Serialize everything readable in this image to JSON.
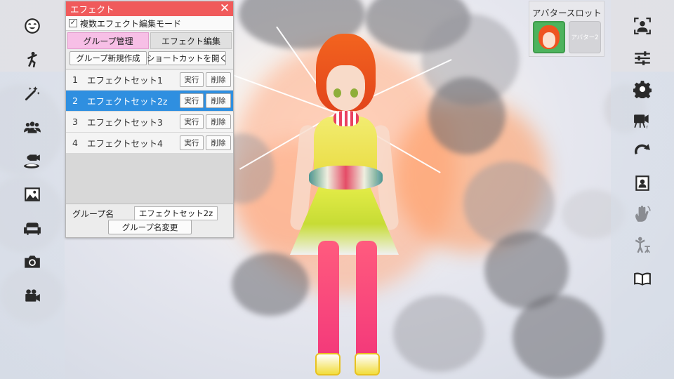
{
  "panel": {
    "title": "エフェクト",
    "close_symbol": "✕",
    "multi_edit_label": "複数エフェクト編集モード",
    "multi_edit_checked": true,
    "tabs": [
      {
        "label": "グループ管理",
        "active": true
      },
      {
        "label": "エフェクト編集",
        "active": false
      }
    ],
    "new_group_label": "グループ新規作成",
    "open_shortcut_label": "ショートカットを開く",
    "effect_sets": [
      {
        "num": "1",
        "name": "エフェクトセット1",
        "run": "実行",
        "delete": "削除",
        "selected": false
      },
      {
        "num": "2",
        "name": "エフェクトセット2z",
        "run": "実行",
        "delete": "削除",
        "selected": true
      },
      {
        "num": "3",
        "name": "エフェクトセット3",
        "run": "実行",
        "delete": "削除",
        "selected": false
      },
      {
        "num": "4",
        "name": "エフェクトセット4",
        "run": "実行",
        "delete": "削除",
        "selected": false
      }
    ],
    "group_name_label": "グループ名",
    "group_name_value": "エフェクトセット2z",
    "rename_label": "グループ名変更"
  },
  "avatar_slots": {
    "title": "アバタースロット",
    "slots": [
      {
        "label": "",
        "active": true
      },
      {
        "label": "アバター2",
        "active": false
      }
    ]
  },
  "left_toolbar": [
    {
      "icon": "face-icon"
    },
    {
      "icon": "pose-icon"
    },
    {
      "icon": "magic-wand-icon"
    },
    {
      "icon": "group-icon"
    },
    {
      "icon": "stage-camera-icon"
    },
    {
      "icon": "image-icon"
    },
    {
      "icon": "sofa-icon"
    },
    {
      "icon": "camera-icon"
    },
    {
      "icon": "video-camera-icon"
    }
  ],
  "right_toolbar": [
    {
      "icon": "person-frame-icon"
    },
    {
      "icon": "sliders-icon"
    },
    {
      "icon": "gear-icon"
    },
    {
      "icon": "recording-camera-icon"
    },
    {
      "icon": "redo-arrow-icon"
    },
    {
      "icon": "portrait-icon"
    },
    {
      "icon": "wave-hand-icon"
    },
    {
      "icon": "motion-capture-icon"
    },
    {
      "icon": "book-icon"
    }
  ],
  "colors": {
    "title_bar": "#f05a5b",
    "selected_row": "#2f8fe0",
    "active_tab": "#f7bfe6",
    "icon": "#2a2a2a"
  }
}
